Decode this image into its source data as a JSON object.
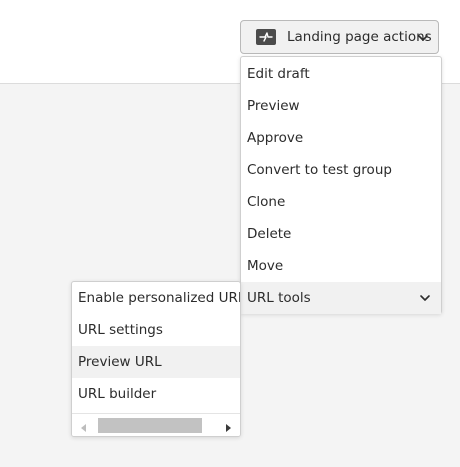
{
  "header": {
    "actions_button_label": "Landing page actions",
    "actions_icon": "landing-page-icon",
    "chevron_icon": "chevron-down-icon"
  },
  "actions_menu": {
    "items": [
      {
        "label": "Edit draft"
      },
      {
        "label": "Preview"
      },
      {
        "label": "Approve"
      },
      {
        "label": "Convert to test group"
      },
      {
        "label": "Clone"
      },
      {
        "label": "Delete"
      },
      {
        "label": "Move"
      },
      {
        "label": "URL tools",
        "has_submenu": true,
        "highlighted": true
      }
    ]
  },
  "url_tools_submenu": {
    "items": [
      {
        "label": "Enable personalized URLs"
      },
      {
        "label": "URL settings"
      },
      {
        "label": "Preview URL",
        "highlighted": true
      },
      {
        "label": "URL builder"
      }
    ]
  },
  "colors": {
    "menu_highlight": "#f1f1f1",
    "button_bg": "#f1f1f1",
    "page_bg": "#f4f4f4"
  }
}
